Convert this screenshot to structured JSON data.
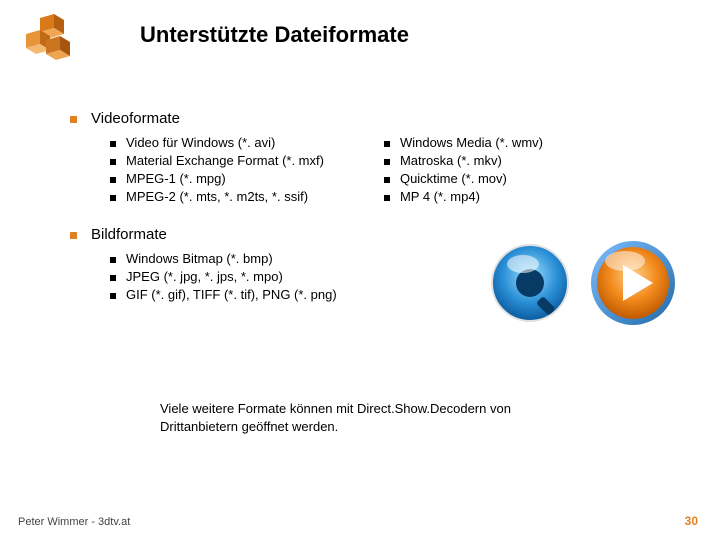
{
  "title": "Unterstützte Dateiformate",
  "sections": {
    "video": {
      "heading": "Videoformate",
      "left": [
        "Video für Windows (*. avi)",
        "Material Exchange Format (*. mxf)",
        "MPEG-1 (*. mpg)",
        "MPEG-2 (*. mts, *. m2ts, *. ssif)"
      ],
      "right": [
        "Windows Media (*. wmv)",
        "Matroska (*. mkv)",
        "Quicktime (*. mov)",
        "MP 4 (*. mp4)"
      ]
    },
    "image": {
      "heading": "Bildformate",
      "items": [
        "Windows Bitmap (*. bmp)",
        "JPEG (*. jpg, *. jps, *. mpo)",
        "GIF (*. gif), TIFF (*. tif), PNG (*. png)"
      ]
    }
  },
  "footnote": "Viele weitere Formate können mit Direct.Show.Decodern von Drittanbietern geöffnet werden.",
  "footer": {
    "author": "Peter Wimmer - 3dtv.at",
    "page": "30"
  },
  "icons": {
    "quicktime": "quicktime-icon",
    "wmp": "windows-media-player-icon"
  }
}
